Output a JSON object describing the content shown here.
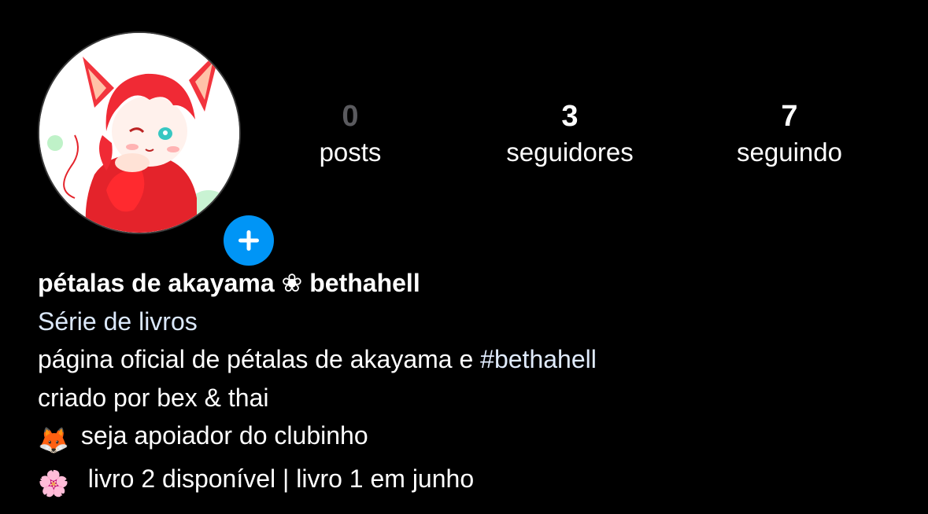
{
  "profile": {
    "add_story_label": "+",
    "stats": [
      {
        "count": "0",
        "label": "posts"
      },
      {
        "count": "3",
        "label": "seguidores"
      },
      {
        "count": "7",
        "label": "seguindo"
      }
    ],
    "name": "pétalas de akayama ❀ bethahell",
    "category": "Série de livros",
    "bio": {
      "line1_text": "página oficial de pétalas de akayama e ",
      "line1_hashtag": "#bethahell",
      "line2": "criado por bex & thai",
      "line3_emoji": "🦊",
      "line3_text": " seja apoiador do clubinho",
      "line4_emoji": "🌸",
      "line4_text": "  livro 2 disponível | livro 1 em junho"
    }
  },
  "colors": {
    "background": "#000000",
    "accent": "#0095f6",
    "link": "#e0ebfd",
    "dim_count": "#5a5a5e"
  },
  "icons": {
    "avatar": "anime-fox-girl-avatar",
    "add_badge": "plus-icon",
    "fox": "fox-face-icon",
    "flower": "cherry-blossom-icon"
  }
}
